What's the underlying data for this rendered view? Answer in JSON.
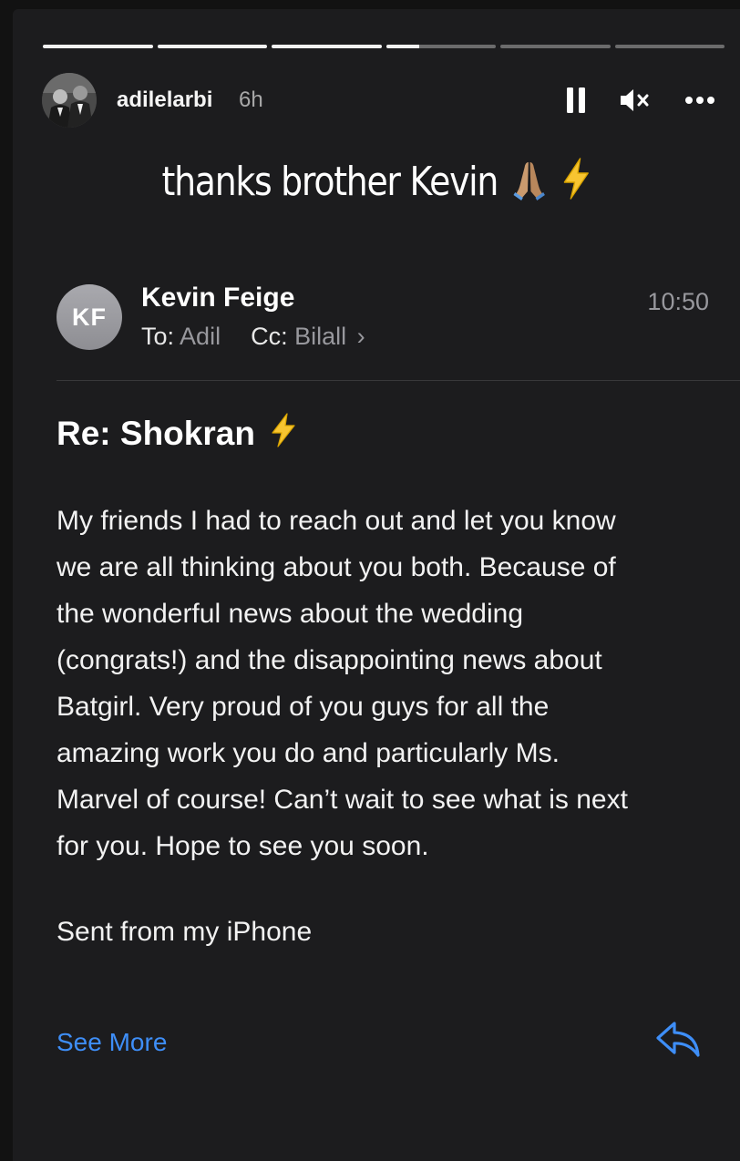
{
  "story": {
    "progress": [
      1,
      1,
      1,
      0.3,
      0,
      0
    ],
    "username": "adilelarbi",
    "time_ago": "6h",
    "controls": {
      "pause_icon": "pause-icon",
      "mute_icon": "speaker-muted-icon",
      "more_icon": "more-horizontal-icon"
    },
    "caption": "thanks brother Kevin",
    "caption_emoji": [
      "folded-hands",
      "high-voltage"
    ]
  },
  "email": {
    "avatar_initials": "KF",
    "sender": "Kevin Feige",
    "time": "10:50",
    "to_label": "To:",
    "to_value": "Adil",
    "cc_label": "Cc:",
    "cc_value": "Bilall",
    "chevron": "›",
    "subject": "Re: Shokran",
    "body_lines": [
      "My friends I had to reach out and let you know",
      "we are all thinking about you both. Because of",
      "the wonderful news about the wedding",
      "(congrats!) and the disappointing news about",
      "Batgirl. Very proud of you guys for all the",
      "amazing work you do and particularly Ms.",
      "Marvel of course!  Can’t wait to see what is next",
      "for you. Hope to see you soon."
    ],
    "signature": "Sent from my iPhone",
    "see_more": "See More",
    "reply_icon": "reply-arrow-icon"
  },
  "colors": {
    "background": "#1c1c1e",
    "link_blue": "#3e8ef7",
    "secondary_text": "#98989d",
    "avatar_gray": "#8e8e93"
  }
}
